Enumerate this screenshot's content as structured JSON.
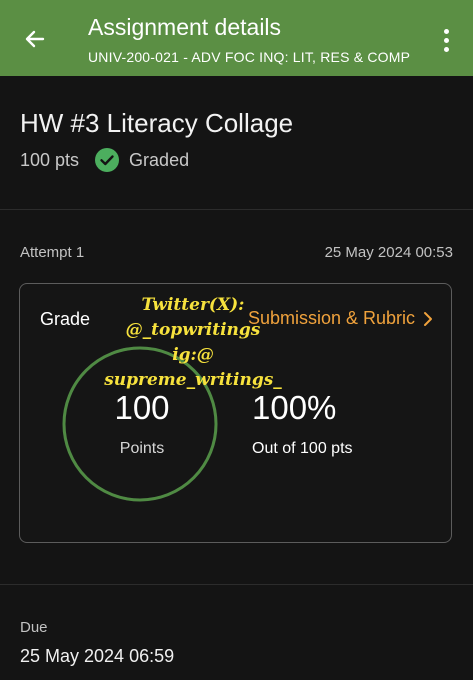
{
  "header": {
    "title": "Assignment details",
    "subtitle": "UNIV-200-021 - ADV FOC INQ: LIT, RES & COMP",
    "back_icon": "arrow-left-icon",
    "menu_icon": "more-vertical-icon"
  },
  "assignment": {
    "title": "HW #3 Literacy Collage",
    "points": "100 pts",
    "status": "Graded",
    "status_icon": "check-circle-icon"
  },
  "attempt": {
    "label": "Attempt 1",
    "date": "25 May 2024 00:53"
  },
  "grade": {
    "label": "Grade",
    "link_label": "Submission & Rubric",
    "link_icon": "chevron-right-icon",
    "points_value": "100",
    "points_label": "Points",
    "percent_value": "100%",
    "out_of": "Out of 100 pts",
    "progress_fraction": 1.0
  },
  "watermark": {
    "lines": [
      "Twitter(X):",
      "@_topwritings",
      "ig:@",
      "supreme_writings_"
    ]
  },
  "due": {
    "label": "Due",
    "date": "25 May 2024 06:59"
  },
  "colors": {
    "header_bg": "#5b8f44",
    "accent_green": "#4cae5e",
    "ring_green": "#4f8a43",
    "link_orange": "#f0a23c",
    "watermark_yellow": "#f7e23d",
    "background": "#141414"
  }
}
